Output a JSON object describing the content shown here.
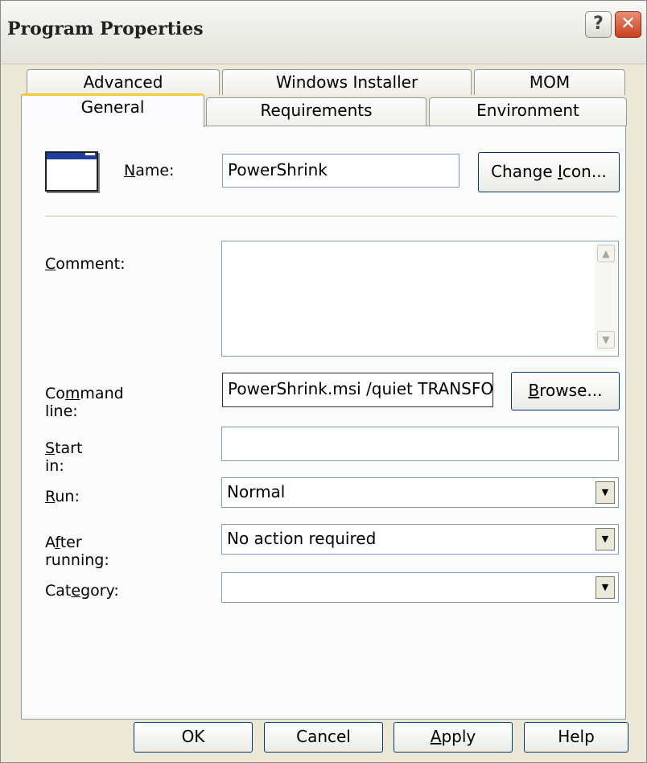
{
  "window": {
    "title": "Program Properties",
    "help_glyph": "?",
    "close_glyph": "✕"
  },
  "tabs_back": [
    "Advanced",
    "Windows Installer",
    "MOM"
  ],
  "tabs_front": [
    "General",
    "Requirements",
    "Environment"
  ],
  "active_tab": "General",
  "general": {
    "name_label_prefix": "",
    "name_label_mnemonic": "N",
    "name_label_rest": "ame:",
    "name_value": "PowerShrink",
    "change_icon_prefix": "Change ",
    "change_icon_mnemonic": "I",
    "change_icon_rest": "con...",
    "comment_mnemonic": "C",
    "comment_rest": "omment:",
    "comment_value": "",
    "command_prefix": "Co",
    "command_mnemonic": "m",
    "command_rest": "mand line:",
    "command_value": "PowerShrink.msi /quiet TRANSFO",
    "browse_mnemonic": "B",
    "browse_rest": "rowse...",
    "startin_mnemonic": "S",
    "startin_rest": "tart in:",
    "startin_value": "",
    "run_mnemonic": "R",
    "run_rest": "un:",
    "run_value": "Normal",
    "after_prefix": "A",
    "after_mnemonic": "f",
    "after_rest": "ter running:",
    "after_value": "No action required",
    "category_prefix": "Cat",
    "category_mnemonic": "e",
    "category_rest": "gory:",
    "category_value": ""
  },
  "buttons": {
    "ok": "OK",
    "cancel": "Cancel",
    "apply_mnemonic": "A",
    "apply_rest": "pply",
    "help": "Help"
  },
  "icons": {
    "program_icon": "window-icon",
    "combo_arrow": "▼",
    "scroll_up": "▲",
    "scroll_down": "▼"
  }
}
